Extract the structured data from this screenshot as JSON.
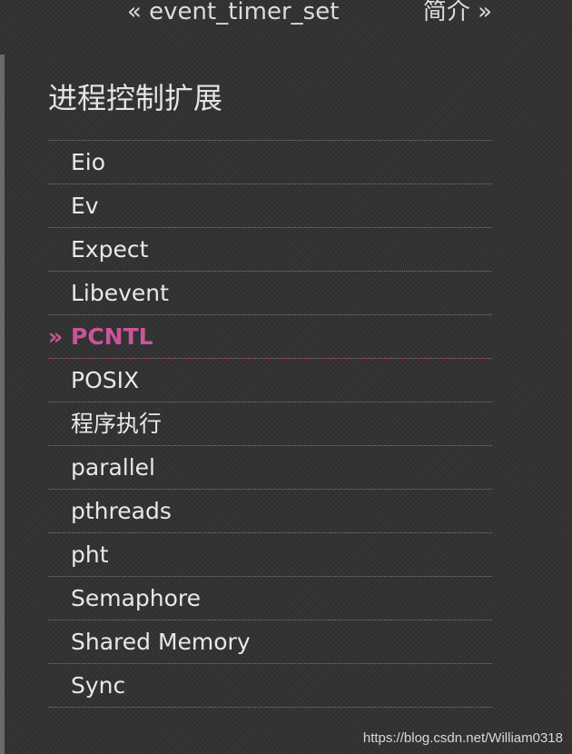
{
  "nav": {
    "prev_label": "« event_timer_set",
    "next_label": "简介 »"
  },
  "sidebar": {
    "title": "进程控制扩展",
    "items": [
      {
        "label": "Eio",
        "active": false
      },
      {
        "label": "Ev",
        "active": false
      },
      {
        "label": "Expect",
        "active": false
      },
      {
        "label": "Libevent",
        "active": false
      },
      {
        "label": "PCNTL",
        "active": true,
        "marker": "»"
      },
      {
        "label": "POSIX",
        "active": false
      },
      {
        "label": "程序执行",
        "active": false
      },
      {
        "label": "parallel",
        "active": false
      },
      {
        "label": "pthreads",
        "active": false
      },
      {
        "label": "pht",
        "active": false
      },
      {
        "label": "Semaphore",
        "active": false
      },
      {
        "label": "Shared Memory",
        "active": false
      },
      {
        "label": "Sync",
        "active": false
      }
    ]
  },
  "watermark": "https://blog.csdn.net/William0318",
  "colors": {
    "background": "#333333",
    "text": "#e6e6e6",
    "active": "#c9559a",
    "rail": "#6a6a6a"
  }
}
